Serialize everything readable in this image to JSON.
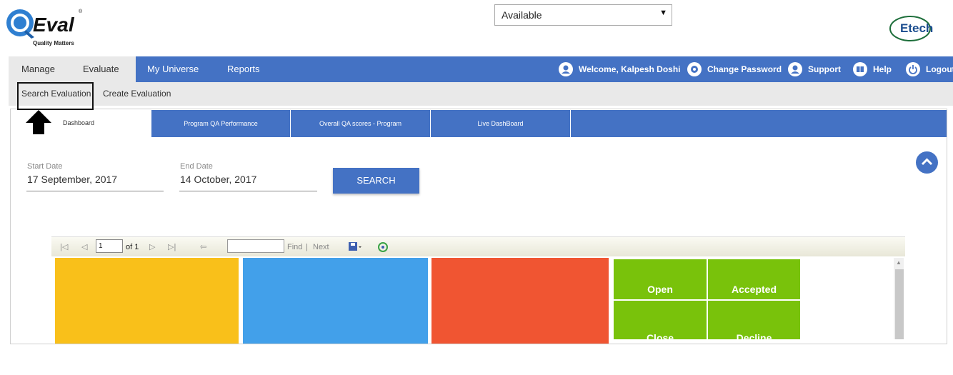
{
  "header": {
    "logo_text": "Q-Eval",
    "logo_tagline": "Quality Matters",
    "status_value": "Available",
    "partner_logo_text": "Etech"
  },
  "nav": {
    "items": [
      {
        "label": "Manage"
      },
      {
        "label": "Evaluate"
      },
      {
        "label": "My Universe"
      },
      {
        "label": "Reports"
      }
    ],
    "right": {
      "welcome": "Welcome, Kalpesh Doshi",
      "change_password": "Change Password",
      "support": "Support",
      "help": "Help",
      "logout": "Logout"
    }
  },
  "subnav": {
    "search_evaluation": "Search Evaluation",
    "create_evaluation": "Create Evaluation"
  },
  "tabs": [
    {
      "label": "Dashboard"
    },
    {
      "label": "Program QA Performance"
    },
    {
      "label": "Overall QA scores - Program"
    },
    {
      "label": "Live DashBoard"
    }
  ],
  "filters": {
    "start_date_label": "Start Date",
    "start_date_value": "17 September, 2017",
    "end_date_label": "End Date",
    "end_date_value": "14 October, 2017",
    "search_label": "SEARCH"
  },
  "report_toolbar": {
    "page_value": "1",
    "of_label": "of 1",
    "find_label": "Find",
    "separator": "|",
    "next_label": "Next"
  },
  "tiles": {
    "colors": [
      "#f9c01a",
      "#42a0ea",
      "#f05532",
      "#79c20b"
    ],
    "status_cells": [
      "Open",
      "Accepted",
      "Close",
      "Decline"
    ]
  }
}
